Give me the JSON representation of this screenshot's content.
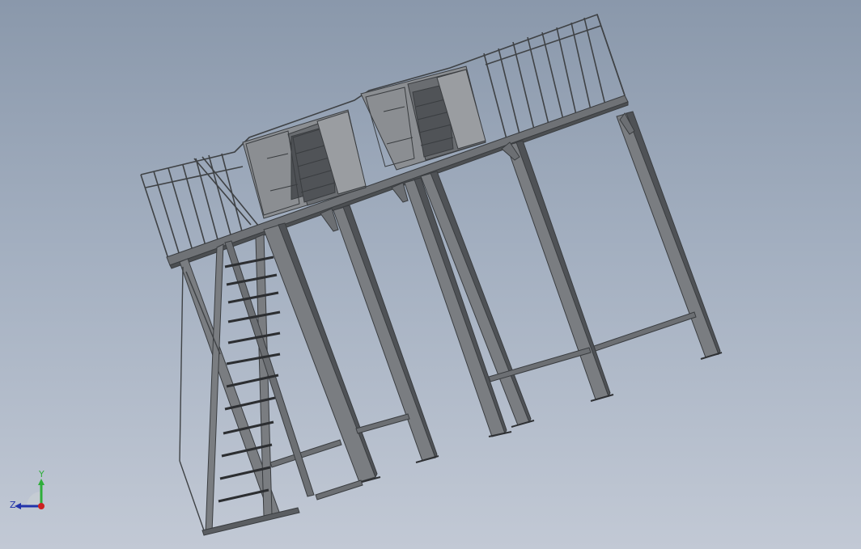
{
  "viewport": {
    "background_top": "#8a98ab",
    "background_bottom": "#c2c9d5"
  },
  "model": {
    "description_icon": "steel-platform-with-ladder",
    "line_color": "#3a3d40",
    "face_color": "#7d8084",
    "dark_face_color": "#55585c"
  },
  "triad": {
    "y_label": "Y",
    "z_label": "Z",
    "y_color": "#2fae3a",
    "z_color": "#2233aa",
    "x_color": "#cc2222"
  }
}
